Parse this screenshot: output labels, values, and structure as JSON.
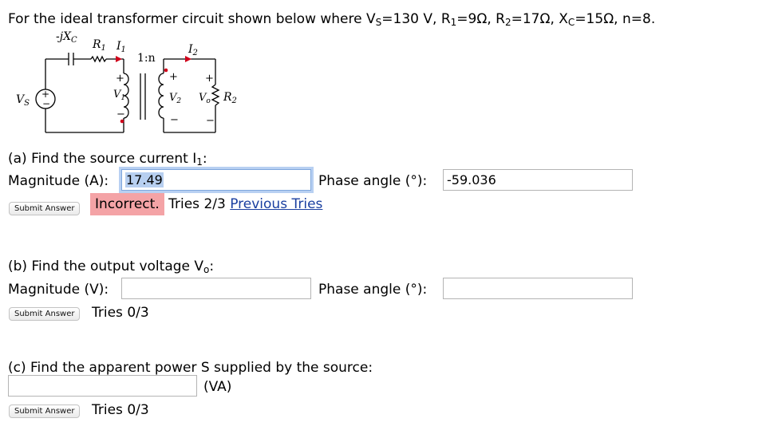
{
  "problem": {
    "text_before": "For the ideal transformer circuit shown below where ",
    "vs_sym": "V",
    "vs_sub": "S",
    "vs_val": "=130 V, ",
    "r1_sym": "R",
    "r1_sub": "1",
    "r1_val": "=9Ω, ",
    "r2_sym": "R",
    "r2_sub": "2",
    "r2_val": "=17Ω, ",
    "xc_sym": "X",
    "xc_sub": "C",
    "xc_val": "=15Ω, n=8."
  },
  "circuit": {
    "xc_label": "-jX",
    "xc_sub": "C",
    "r1_label": "R",
    "r1_sub": "1",
    "i1_label": "I",
    "i1_sub": "1",
    "ratio": "1:n",
    "i2_label": "I",
    "i2_sub": "2",
    "vs_label": "V",
    "vs_sub": "S",
    "v1_label": "V",
    "v1_sub": "1",
    "v2_label": "V",
    "v2_sub": "2",
    "vo_label": "V",
    "vo_sub": "o",
    "r2_label": "R",
    "r2_sub": "2",
    "plus": "+",
    "minus": "−"
  },
  "part_a": {
    "question": "(a) Find the source current I",
    "question_sub": "1",
    "question_end": ":",
    "magnitude_label": "Magnitude (A):",
    "magnitude_value": "17.49",
    "phase_label": "Phase angle (°):",
    "phase_value": "-59.036",
    "submit": "Submit Answer",
    "status": "Incorrect.",
    "tries": "Tries 2/3",
    "previous": "Previous Tries"
  },
  "part_b": {
    "question": "(b) Find the output voltage V",
    "question_sub": "o",
    "question_end": ":",
    "magnitude_label": "Magnitude (V):",
    "phase_label": "Phase angle (°):",
    "submit": "Submit Answer",
    "tries": "Tries 0/3"
  },
  "part_c": {
    "question": "(c) Find the apparent power S supplied by the source:",
    "unit": "(VA)",
    "submit": "Submit Answer",
    "tries": "Tries 0/3"
  }
}
